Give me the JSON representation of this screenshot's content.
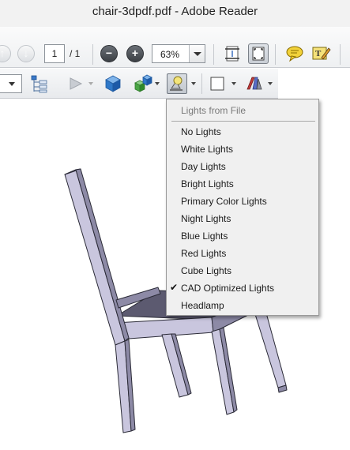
{
  "window": {
    "title": "chair-3dpdf.pdf - Adobe Reader"
  },
  "toolbar": {
    "page_current": "1",
    "page_total": "/ 1",
    "zoom_value": "63%"
  },
  "lights_menu": {
    "header": "Lights from File",
    "items": [
      {
        "label": "No Lights",
        "checked": false
      },
      {
        "label": "White Lights",
        "checked": false
      },
      {
        "label": "Day Lights",
        "checked": false
      },
      {
        "label": "Bright Lights",
        "checked": false
      },
      {
        "label": "Primary Color Lights",
        "checked": false
      },
      {
        "label": "Night Lights",
        "checked": false
      },
      {
        "label": "Blue Lights",
        "checked": false
      },
      {
        "label": "Red Lights",
        "checked": false
      },
      {
        "label": "Cube Lights",
        "checked": false
      },
      {
        "label": "CAD Optimized Lights",
        "checked": true
      },
      {
        "label": "Headlamp",
        "checked": false
      }
    ],
    "check_mark": "✔"
  },
  "icons": {
    "prev_page": "up-arrow-icon",
    "next_page": "down-arrow-icon",
    "zoom_out": "minus-icon",
    "zoom_in": "plus-icon",
    "fit_page": "fit-page-icon",
    "fit_width": "fit-width-icon",
    "comment": "speech-bubble-icon",
    "sign": "pen-note-icon",
    "model_tree": "model-tree-icon",
    "play": "play-icon",
    "default_view": "cube-icon",
    "views": "cubes-icon",
    "lighting": "lamp-icon",
    "background": "color-swatch-icon",
    "render_mode": "render-mode-icon"
  },
  "colors": {
    "chair_face": "#c9c6de",
    "chair_side": "#8d8aa6",
    "chair_dark": "#5c5a70",
    "outline": "#2a2a36"
  }
}
